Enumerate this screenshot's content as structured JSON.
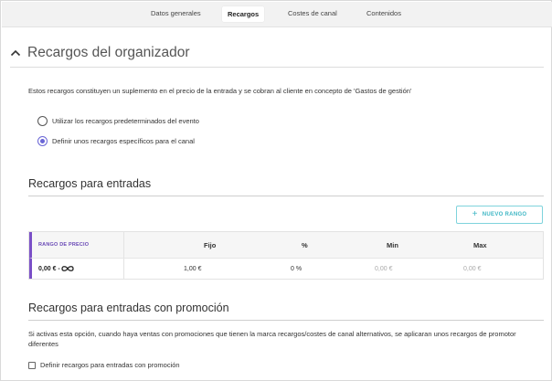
{
  "tabs": [
    {
      "label": "Datos generales",
      "active": false
    },
    {
      "label": "Recargos",
      "active": true
    },
    {
      "label": "Costes de canal",
      "active": false
    },
    {
      "label": "Contenidos",
      "active": false
    }
  ],
  "section": {
    "title": "Recargos del organizador",
    "description": "Estos recargos constituyen un suplemento en el precio de la entrada y se cobran al cliente en concepto de 'Gastos de gestión'",
    "options": [
      {
        "label": "Utilizar los recargos predeterminados del evento",
        "checked": false
      },
      {
        "label": "Definir unos recargos específicos para el canal",
        "checked": true
      }
    ]
  },
  "tickets": {
    "title": "Recargos para entradas",
    "new_range_label": "NUEVO RANGO",
    "columns": [
      "RANGO DE PRECIO",
      "Fijo",
      "%",
      "Min",
      "Max"
    ],
    "rows": [
      {
        "range": "0,00 € - ",
        "fixed": "1,00 €",
        "percent": "0 %",
        "min": "0,00 €",
        "max": "0,00 €"
      }
    ]
  },
  "promo": {
    "title": "Recargos para entradas con promoción",
    "description": "Si activas esta opción, cuando haya ventas con promociones que tienen la marca recargos/costes de canal alternativos, se aplicaran unos recargos de promotor diferentes",
    "checkbox_label": "Definir recargos para entradas con promoción",
    "checked": false
  },
  "colors": {
    "accent_purple": "#7a4fc7",
    "radio_purple": "#6a66d6",
    "button_teal": "#3db6c4"
  }
}
